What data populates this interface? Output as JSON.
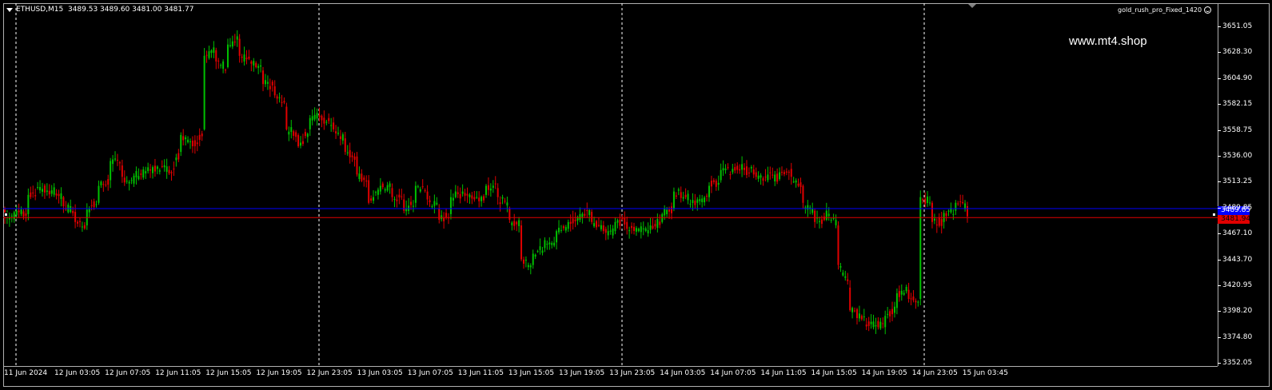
{
  "header": {
    "symbol_info": "ETHUSD,M15  3489.53 3489.60 3481.00 3481.77",
    "indicator_name": "gold_rush_pro_Fixed_1420",
    "watermark": "www.mt4.shop"
  },
  "price_scale": {
    "ticks": [
      "3651.05",
      "3628.30",
      "3604.90",
      "3582.15",
      "3558.75",
      "3536.00",
      "3513.25",
      "3489.85",
      "3467.10",
      "3443.70",
      "3420.95",
      "3398.20",
      "3374.80",
      "3352.05"
    ],
    "bid_label": "3481.94",
    "ask_label": "3489.85"
  },
  "time_scale": {
    "labels": [
      "11 Jun 2024",
      "12 Jun 03:05",
      "12 Jun 07:05",
      "12 Jun 11:05",
      "12 Jun 15:05",
      "12 Jun 19:05",
      "12 Jun 23:05",
      "13 Jun 03:05",
      "13 Jun 07:05",
      "13 Jun 11:05",
      "13 Jun 15:05",
      "13 Jun 19:05",
      "13 Jun 23:05",
      "14 Jun 03:05",
      "14 Jun 07:05",
      "14 Jun 11:05",
      "14 Jun 15:05",
      "14 Jun 19:05",
      "14 Jun 23:05",
      "15 Jun 03:45"
    ]
  },
  "colors": {
    "background": "#000000",
    "bull": "#00c000",
    "bear": "#e00000",
    "bid_line": "#e00000",
    "ask_line": "#0000ff",
    "grid": "#ffffff"
  },
  "chart_data": {
    "type": "candlestick",
    "symbol": "ETHUSD",
    "timeframe": "M15",
    "ylim": [
      3352.05,
      3651.05
    ],
    "bid": 3481.94,
    "ask": 3489.85,
    "keypoints": [
      [
        3489,
        3483
      ],
      [
        3484,
        3488
      ],
      [
        3485,
        3502
      ],
      [
        3506,
        3509
      ],
      [
        3503,
        3506
      ],
      [
        3500,
        3492
      ],
      [
        3487,
        3478
      ],
      [
        3475,
        3489
      ],
      [
        3495,
        3510
      ],
      [
        3515,
        3532
      ],
      [
        3528,
        3518
      ],
      [
        3512,
        3519
      ],
      [
        3521,
        3523
      ],
      [
        3525,
        3527
      ],
      [
        3524,
        3521
      ],
      [
        3540,
        3555
      ],
      [
        3550,
        3545
      ],
      [
        3560,
        3625
      ],
      [
        3630,
        3620
      ],
      [
        3615,
        3635
      ],
      [
        3640,
        3625
      ],
      [
        3620,
        3618
      ],
      [
        3612,
        3600
      ],
      [
        3598,
        3590
      ],
      [
        3580,
        3560
      ],
      [
        3555,
        3545
      ],
      [
        3560,
        3570
      ],
      [
        3572,
        3568
      ],
      [
        3566,
        3560
      ],
      [
        3552,
        3540
      ],
      [
        3536,
        3520
      ],
      [
        3515,
        3495
      ],
      [
        3505,
        3510
      ],
      [
        3508,
        3500
      ],
      [
        3498,
        3488
      ],
      [
        3495,
        3510
      ],
      [
        3505,
        3498
      ],
      [
        3490,
        3480
      ],
      [
        3485,
        3500
      ],
      [
        3503,
        3505
      ],
      [
        3500,
        3498
      ],
      [
        3502,
        3510
      ],
      [
        3508,
        3500
      ],
      [
        3490,
        3480
      ],
      [
        3475,
        3445
      ],
      [
        3440,
        3450
      ],
      [
        3455,
        3462
      ],
      [
        3460,
        3470
      ],
      [
        3472,
        3478
      ],
      [
        3480,
        3485
      ],
      [
        3487,
        3478
      ],
      [
        3475,
        3470
      ],
      [
        3470,
        3478
      ],
      [
        3478,
        3472
      ],
      [
        3470,
        3472
      ],
      [
        3471,
        3475
      ],
      [
        3478,
        3485
      ],
      [
        3490,
        3505
      ],
      [
        3502,
        3500
      ],
      [
        3495,
        3498
      ],
      [
        3500,
        3510
      ],
      [
        3515,
        3524
      ],
      [
        3522,
        3525
      ],
      [
        3526,
        3524
      ],
      [
        3522,
        3518
      ],
      [
        3515,
        3520
      ],
      [
        3516,
        3522
      ],
      [
        3525,
        3518
      ],
      [
        3510,
        3495
      ],
      [
        3488,
        3478
      ],
      [
        3480,
        3488
      ],
      [
        3475,
        3440
      ],
      [
        3420,
        3400
      ],
      [
        3395,
        3392
      ],
      [
        3385,
        3390
      ],
      [
        3385,
        3395
      ],
      [
        3402,
        3415
      ],
      [
        3418,
        3410
      ],
      [
        3410,
        3500
      ],
      [
        3495,
        3478
      ],
      [
        3478,
        3486
      ],
      [
        3488,
        3495
      ],
      [
        3492,
        3483
      ]
    ]
  }
}
